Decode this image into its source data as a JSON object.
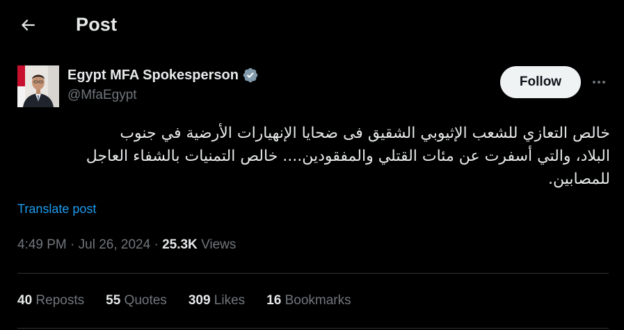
{
  "header": {
    "title": "Post",
    "back_icon": "arrow-left-icon"
  },
  "author": {
    "name": "Egypt MFA Spokesperson",
    "handle": "@MfaEgypt",
    "verified_icon": "verified-badge-icon",
    "verified_color": "#829aab"
  },
  "follow": {
    "label": "Follow"
  },
  "more": {
    "icon": "more-horizontal-icon"
  },
  "post": {
    "text": "خالص التعازي للشعب الإثيوبي الشقيق فى ضحايا الإنهيارات الأرضية في جنوب\nالبلاد، والتي أسفرت عن مئات القتلي والمفقودين.... خالص التمنيات بالشفاء العاجل\nللمصابين.",
    "translate_label": "Translate post"
  },
  "meta": {
    "time": "4:49 PM",
    "separator": " · ",
    "date": "Jul 26, 2024",
    "views_count": "25.3K",
    "views_label": "Views"
  },
  "stats": [
    {
      "count": "40",
      "label": "Reposts"
    },
    {
      "count": "55",
      "label": "Quotes"
    },
    {
      "count": "309",
      "label": "Likes"
    },
    {
      "count": "16",
      "label": "Bookmarks"
    }
  ],
  "colors": {
    "background": "#000000",
    "text": "#e7e9ea",
    "muted": "#71767b",
    "link": "#1d9bf0",
    "divider": "#2f3336"
  }
}
